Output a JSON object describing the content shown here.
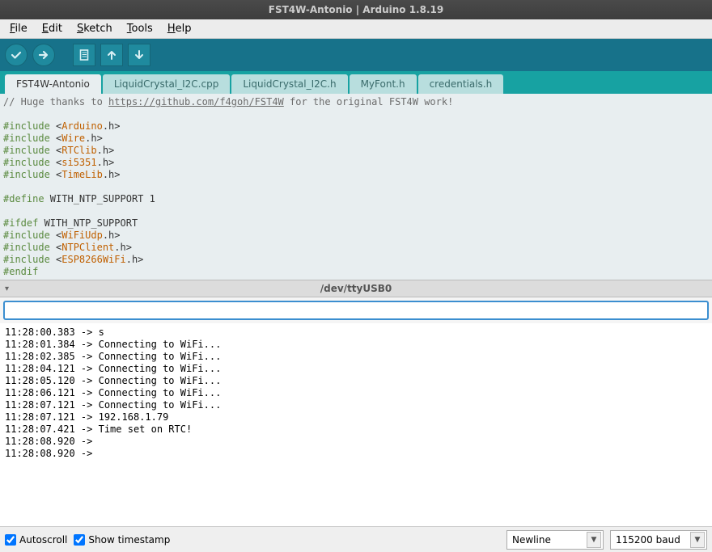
{
  "window": {
    "title": "FST4W-Antonio | Arduino 1.8.19"
  },
  "menu": {
    "file": "File",
    "edit": "Edit",
    "sketch": "Sketch",
    "tools": "Tools",
    "help": "Help"
  },
  "tabs": [
    {
      "label": "FST4W-Antonio",
      "active": true
    },
    {
      "label": "LiquidCrystal_I2C.cpp",
      "active": false
    },
    {
      "label": "LiquidCrystal_I2C.h",
      "active": false
    },
    {
      "label": "MyFont.h",
      "active": false
    },
    {
      "label": "credentials.h",
      "active": false
    }
  ],
  "code": {
    "comment_prefix": "// Huge thanks to ",
    "comment_link": "https://github.com/f4goh/FST4W",
    "comment_suffix": " for the original FST4W work!",
    "include_kw": "#include",
    "define_kw": "#define",
    "ifdef_kw": "#ifdef",
    "endif_kw": "#endif",
    "lt": " <",
    "gt": ">",
    "dot_h_gt": ".h>",
    "inc1": "Arduino",
    "inc2": "Wire",
    "inc3": "RTClib",
    "inc4": "si5351",
    "inc5": "TimeLib",
    "define_line": " WITH_NTP_SUPPORT 1",
    "ifdef_line": " WITH_NTP_SUPPORT",
    "inc6": "WiFiUdp",
    "inc7": "NTPClient",
    "inc8": "ESP8266WiFi"
  },
  "serial": {
    "port": "/dev/ttyUSB0",
    "input_value": "",
    "lines": [
      "11:28:00.383 -> s",
      "11:28:01.384 -> Connecting to WiFi...",
      "11:28:02.385 -> Connecting to WiFi...",
      "11:28:04.121 -> Connecting to WiFi...",
      "11:28:05.120 -> Connecting to WiFi...",
      "11:28:06.121 -> Connecting to WiFi...",
      "11:28:07.121 -> Connecting to WiFi...",
      "11:28:07.121 -> 192.168.1.79",
      "11:28:07.421 -> Time set on RTC!",
      "11:28:08.920 -> ",
      "11:28:08.920 -> "
    ]
  },
  "bottom": {
    "autoscroll": "Autoscroll",
    "timestamp": "Show timestamp",
    "line_ending": "Newline",
    "baud": "115200 baud"
  }
}
